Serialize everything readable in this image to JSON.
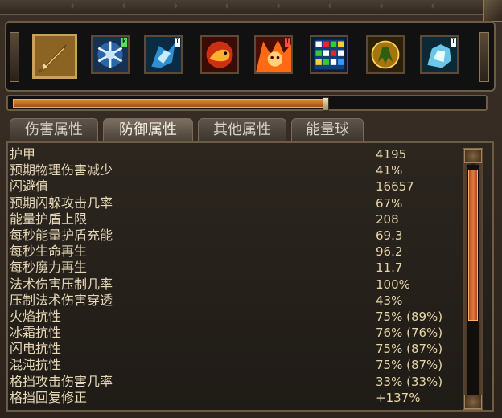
{
  "window": {
    "accent_color": "#caa05a",
    "bar_color": "#e07a3a",
    "text_color": "#e6d7b7"
  },
  "skills": [
    {
      "name": "sword-skill",
      "badge": ""
    },
    {
      "name": "snowflake-skill",
      "badge": "k"
    },
    {
      "name": "ice-armor-skill",
      "badge": "I"
    },
    {
      "name": "fire-hound-skill",
      "badge": ""
    },
    {
      "name": "berserker-skill",
      "badge": "I"
    },
    {
      "name": "multi-color-skill",
      "badge": ""
    },
    {
      "name": "armor-skill",
      "badge": ""
    },
    {
      "name": "ice-fist-skill",
      "badge": "I"
    }
  ],
  "progress": {
    "fraction": 0.665
  },
  "tabs": [
    {
      "label": "伤害属性",
      "active": false
    },
    {
      "label": "防御属性",
      "active": true
    },
    {
      "label": "其他属性",
      "active": false
    },
    {
      "label": "能量球",
      "active": false
    }
  ],
  "stats": [
    {
      "label": "护甲",
      "value": "4195"
    },
    {
      "label": "预期物理伤害减少",
      "value": "41%"
    },
    {
      "label": "闪避值",
      "value": "16657"
    },
    {
      "label": "预期闪躲攻击几率",
      "value": "67%"
    },
    {
      "label": "能量护盾上限",
      "value": "208"
    },
    {
      "label": "每秒能量护盾充能",
      "value": "69.3"
    },
    {
      "label": "每秒生命再生",
      "value": "96.2"
    },
    {
      "label": "每秒魔力再生",
      "value": "11.7"
    },
    {
      "label": "法术伤害压制几率",
      "value": "100%"
    },
    {
      "label": "压制法术伤害穿透",
      "value": "43%"
    },
    {
      "label": "火焰抗性",
      "value": "75% (89%)"
    },
    {
      "label": "冰霜抗性",
      "value": "76% (76%)"
    },
    {
      "label": "闪电抗性",
      "value": "75% (87%)"
    },
    {
      "label": "混沌抗性",
      "value": "75% (87%)"
    },
    {
      "label": "格挡攻击伤害几率",
      "value": "33% (33%)"
    },
    {
      "label": "格挡回复修正",
      "value": "+137%"
    }
  ]
}
